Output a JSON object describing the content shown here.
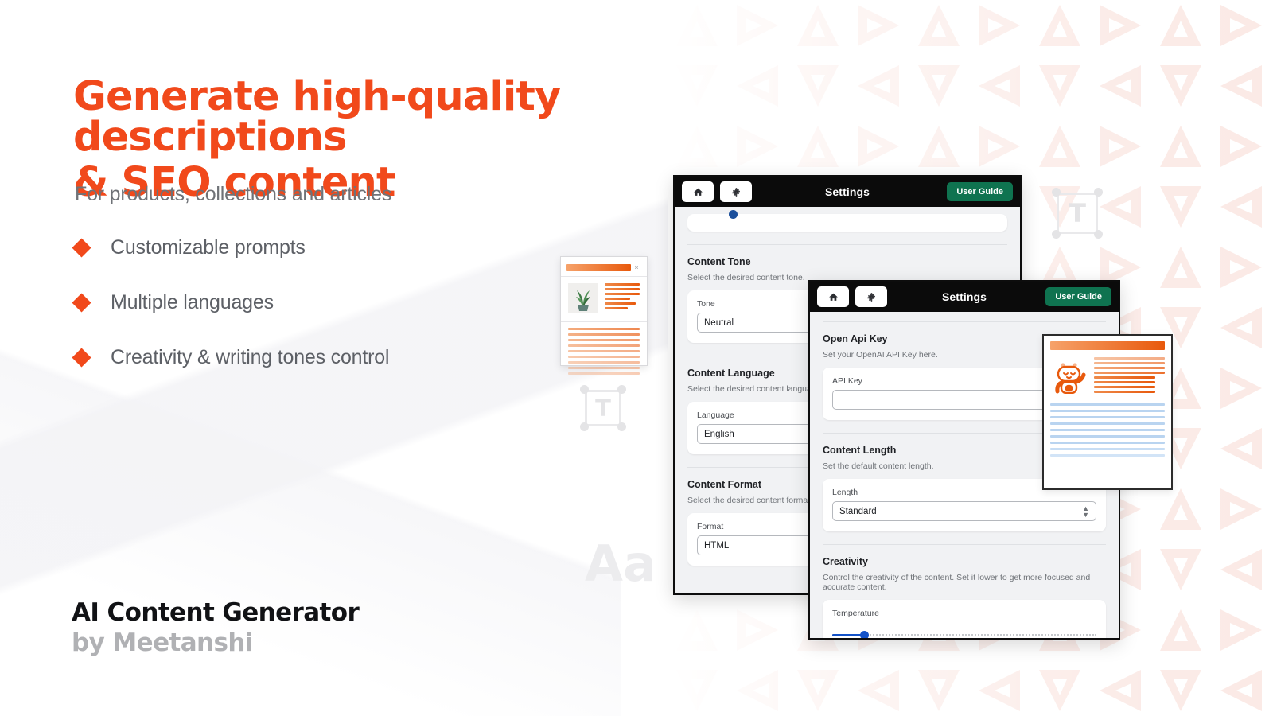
{
  "hero": {
    "headline_line1": "Generate high-quality descriptions",
    "headline_line2": "& SEO content",
    "subhead": "For products, collections and articles",
    "bullets": [
      {
        "label": "Customizable prompts",
        "icon": "diamond-bullet-icon"
      },
      {
        "label": "Multiple languages",
        "icon": "diamond-bullet-icon"
      },
      {
        "label": "Creativity & writing tones control",
        "icon": "diamond-bullet-icon"
      }
    ],
    "brand_name": "AI Content Generator",
    "brand_by": "by Meetanshi"
  },
  "colors": {
    "accent_orange": "#f1491b",
    "headline_orange": "#f1491b",
    "brand_dark": "#111215",
    "brand_gray": "#b0b1b4",
    "panel_header": "#0b0b0b",
    "user_guide_green": "#0f7350",
    "slider_blue": "#1352c8",
    "body_gray": "#6f7378",
    "pattern_pink": "#fbeae6"
  },
  "decor": {
    "textbox_glyph_large": "T",
    "textbox_glyph_small": "T",
    "aa_glyph": "Aa",
    "close_glyph": "×"
  },
  "panel_back": {
    "title": "Settings",
    "home_icon": "home-icon",
    "gear_icon": "gear-icon",
    "user_guide_label": "User Guide",
    "sections": [
      {
        "heading": "Content Tone",
        "description": "Select the desired content tone.",
        "field_label": "Tone",
        "field_value": "Neutral"
      },
      {
        "heading": "Content Language",
        "description": "Select the desired content language.",
        "field_label": "Language",
        "field_value": "English"
      },
      {
        "heading": "Content Format",
        "description": "Select the desired content format.",
        "field_label": "Format",
        "field_value": "HTML"
      }
    ]
  },
  "panel_front": {
    "title": "Settings",
    "home_icon": "home-icon",
    "gear_icon": "gear-icon",
    "user_guide_label": "User Guide",
    "sections": [
      {
        "heading": "Open Api Key",
        "description": "Set your OpenAI API Key here.",
        "field_label": "API Key",
        "field_value": ""
      },
      {
        "heading": "Content Length",
        "description": "Set the default content length.",
        "field_label": "Length",
        "field_value": "Standard"
      },
      {
        "heading": "Creativity",
        "description": "Control the creativity of the content. Set it lower to get more focused and accurate content.",
        "field_label": "Temperature",
        "slider_percent": 12
      }
    ]
  },
  "mock_product_card": {
    "name": "product-preview-card",
    "thumbnail": "plant-thumbnail",
    "close_label": "×"
  },
  "mock_robot_card": {
    "name": "robot-preview-card",
    "thumbnail": "robot-mascot-icon"
  }
}
